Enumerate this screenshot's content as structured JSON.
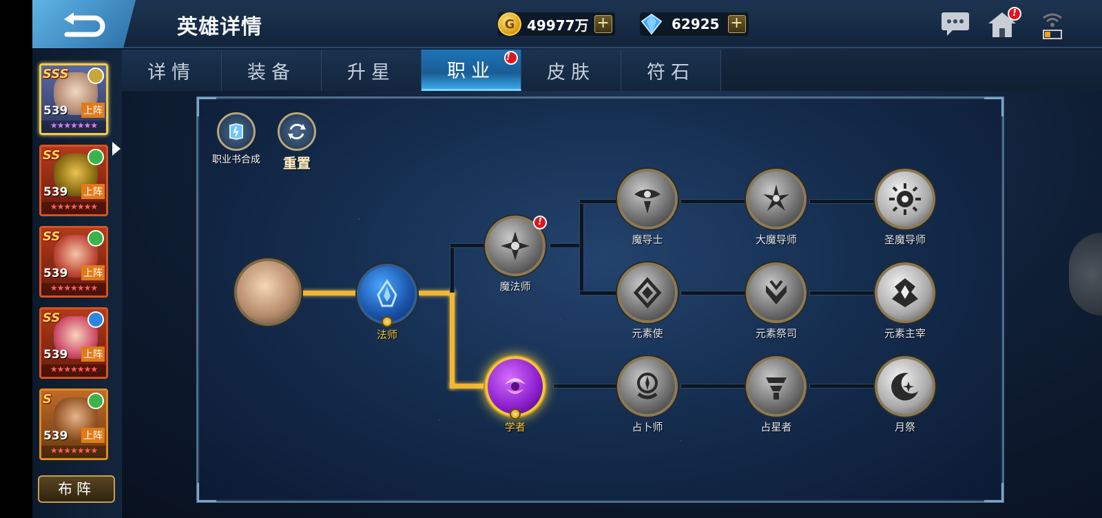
{
  "header": {
    "title": "英雄详情",
    "gold": "49977万",
    "gems": "62925",
    "plus": "+"
  },
  "tabs": [
    {
      "label": "详情",
      "active": false
    },
    {
      "label": "装备",
      "active": false
    },
    {
      "label": "升星",
      "active": false
    },
    {
      "label": "职业",
      "active": true,
      "badge": "!"
    },
    {
      "label": "皮肤",
      "active": false
    },
    {
      "label": "符石",
      "active": false
    }
  ],
  "heroes": [
    {
      "rank": "SSS",
      "level": "539",
      "status": "上阵",
      "stars": "★★★★★★★",
      "element": "light",
      "selected": true
    },
    {
      "rank": "SS",
      "level": "539",
      "status": "上阵",
      "stars": "★★★★★★★",
      "element": "nature",
      "selected": false
    },
    {
      "rank": "SS",
      "level": "539",
      "status": "上阵",
      "stars": "★★★★★★★",
      "element": "nature",
      "selected": false
    },
    {
      "rank": "SS",
      "level": "539",
      "status": "上阵",
      "stars": "★★★★★★★",
      "element": "water",
      "selected": false
    },
    {
      "rank": "S",
      "level": "539",
      "status": "上阵",
      "stars": "★★★★★★★",
      "element": "nature",
      "selected": false
    }
  ],
  "formation_button": "布阵",
  "tools": {
    "synth": "职业书合成",
    "reset": "重置"
  },
  "nodes": {
    "mage": "法师",
    "sorcerer": "魔法师",
    "scholar": "学者",
    "magus": "魔导士",
    "archmagus": "大魔导师",
    "holy_magus": "圣魔导师",
    "elementalist": "元素使",
    "element_priest": "元素祭司",
    "element_lord": "元素主宰",
    "diviner": "占卜师",
    "astrologer": "占星者",
    "moon_rite": "月祭"
  },
  "colors": {
    "path_active": "#f2b631",
    "tab_active": "#1d74b8",
    "badge": "#e1141b"
  }
}
